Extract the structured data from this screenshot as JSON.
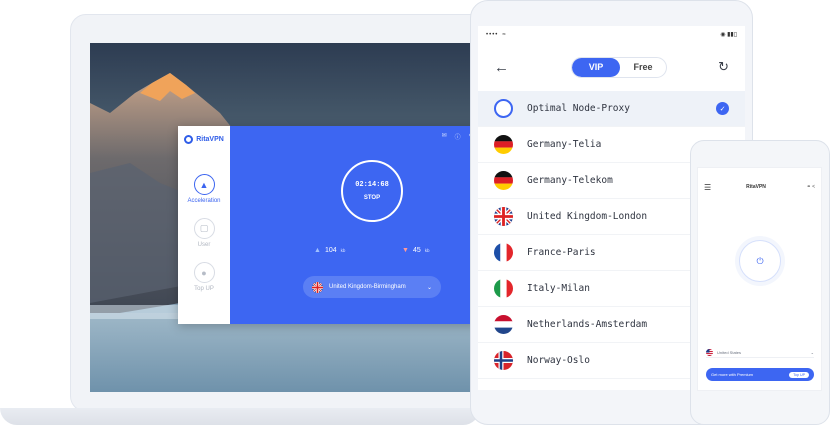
{
  "desktop": {
    "app_name": "RitaVPN",
    "sidebar": [
      {
        "label": "Acceleration",
        "icon": "rocket-icon",
        "active": true
      },
      {
        "label": "User",
        "icon": "cart-icon",
        "active": false
      },
      {
        "label": "Top UP",
        "icon": "user-icon",
        "active": false
      }
    ],
    "timer": "02:14:68",
    "stop_label": "STOP",
    "upload": {
      "value": "104",
      "unit": "kb"
    },
    "download": {
      "value": "45",
      "unit": "kb"
    },
    "region": "United Kingdom-Birmingham"
  },
  "tablet": {
    "tabs": {
      "vip": "VIP",
      "free": "Free"
    },
    "servers": [
      {
        "name": "Optimal Node-Proxy",
        "flag": "globe",
        "selected": true
      },
      {
        "name": "Germany-Telia",
        "flag": "de",
        "selected": false
      },
      {
        "name": "Germany-Telekom",
        "flag": "de",
        "selected": false
      },
      {
        "name": "United Kingdom-London",
        "flag": "gb",
        "selected": false
      },
      {
        "name": "France-Paris",
        "flag": "fr",
        "selected": false
      },
      {
        "name": "Italy-Milan",
        "flag": "it",
        "selected": false
      },
      {
        "name": "Netherlands-Amsterdam",
        "flag": "nl",
        "selected": false
      },
      {
        "name": "Norway-Oslo",
        "flag": "no",
        "selected": false
      }
    ]
  },
  "phone": {
    "title": "RitaVPN",
    "region": "United States",
    "premium_text": "Get more with Premium",
    "topup_label": "Top UP"
  },
  "colors": {
    "accent": "#3d66f2",
    "bg": "#ffffff"
  }
}
